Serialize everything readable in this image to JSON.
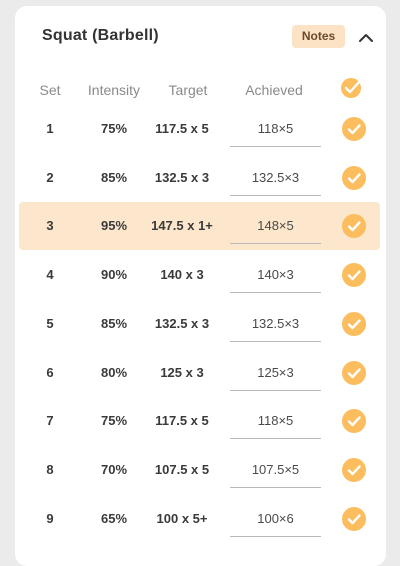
{
  "exercise": {
    "title": "Squat (Barbell)",
    "notes_label": "Notes"
  },
  "columns": {
    "set": "Set",
    "intensity": "Intensity",
    "target": "Target",
    "achieved": "Achieved"
  },
  "accent_color": "#fbbd5d",
  "highlight_color": "#fde7cc",
  "rows": [
    {
      "set": "1",
      "intensity": "75%",
      "target": "117.5 x 5",
      "achieved": "118×5",
      "done": true
    },
    {
      "set": "2",
      "intensity": "85%",
      "target": "132.5 x 3",
      "achieved": "132.5×3",
      "done": true
    },
    {
      "set": "3",
      "intensity": "95%",
      "target": "147.5 x 1+",
      "achieved": "148×5",
      "done": true
    },
    {
      "set": "4",
      "intensity": "90%",
      "target": "140 x 3",
      "achieved": "140×3",
      "done": true
    },
    {
      "set": "5",
      "intensity": "85%",
      "target": "132.5 x 3",
      "achieved": "132.5×3",
      "done": true
    },
    {
      "set": "6",
      "intensity": "80%",
      "target": "125 x 3",
      "achieved": "125×3",
      "done": true
    },
    {
      "set": "7",
      "intensity": "75%",
      "target": "117.5 x 5",
      "achieved": "118×5",
      "done": true
    },
    {
      "set": "8",
      "intensity": "70%",
      "target": "107.5 x 5",
      "achieved": "107.5×5",
      "done": true
    },
    {
      "set": "9",
      "intensity": "65%",
      "target": "100 x 5+",
      "achieved": "100×6",
      "done": true
    }
  ],
  "highlighted_set": "3"
}
